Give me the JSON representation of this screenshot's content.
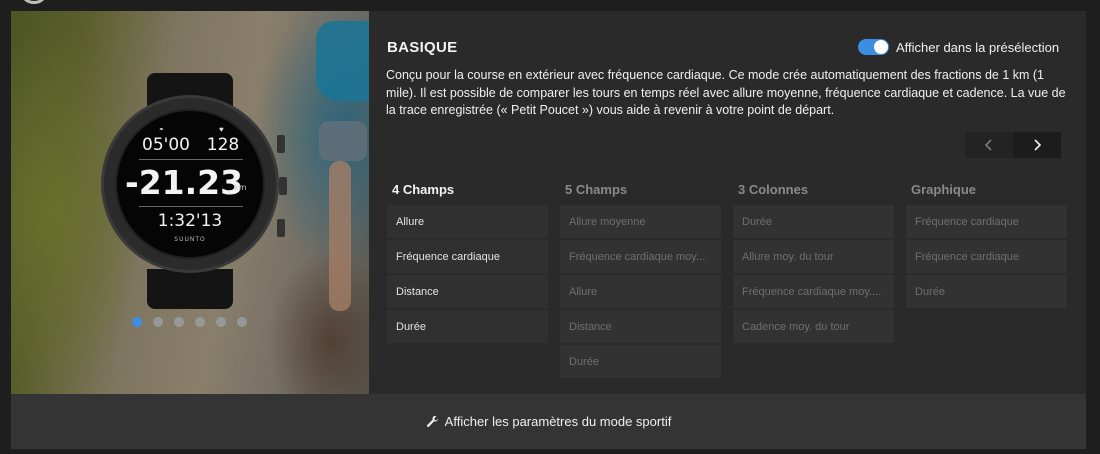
{
  "mode": {
    "title": "BASIQUE",
    "description": "Conçu pour la course en extérieur avec fréquence cardiaque. Ce mode crée automatiquement des fractions de 1 km (1 mile). Il est possible de comparer les tours en temps réel avec allure moyenne, fréquence cardiaque et cadence. La vue de la trace enregistrée (« Petit Poucet ») vous aide à revenir à votre point de départ.",
    "toggle_label": "Afficher dans la présélection",
    "toggle_on": true
  },
  "watch": {
    "pace": "05'00",
    "heart_rate": "128",
    "main_value": "-21.23",
    "unit": "km",
    "time": "1:32'13",
    "brand": "SUUNTO"
  },
  "carousel": {
    "count": 6,
    "active_index": 0
  },
  "columns": [
    {
      "title": "4 Champs",
      "active": true,
      "rows": [
        "Allure",
        "Fréquence cardiaque",
        "Distance",
        "Durée"
      ]
    },
    {
      "title": "5 Champs",
      "active": false,
      "rows": [
        "Allure moyenne",
        "Fréquence cardiaque moy...",
        "Allure",
        "Distance",
        "Durée"
      ]
    },
    {
      "title": "3 Colonnes",
      "active": false,
      "rows": [
        "Durée",
        "Allure moy. du tour",
        "Fréquence cardiaque moy....",
        "Cadence moy. du tour"
      ]
    },
    {
      "title": "Graphique",
      "active": false,
      "rows": [
        "Fréquence cardiaque",
        "Fréquence cardiaque",
        "Durée"
      ]
    }
  ],
  "pager": {
    "prev_icon": "chevron-left-icon",
    "next_icon": "chevron-right-icon"
  },
  "footer": {
    "label": "Afficher les paramètres du mode sportif",
    "icon": "wrench-icon"
  },
  "colors": {
    "accent": "#3b8ee0",
    "panel": "#2a2a2a",
    "footer": "#343434"
  }
}
